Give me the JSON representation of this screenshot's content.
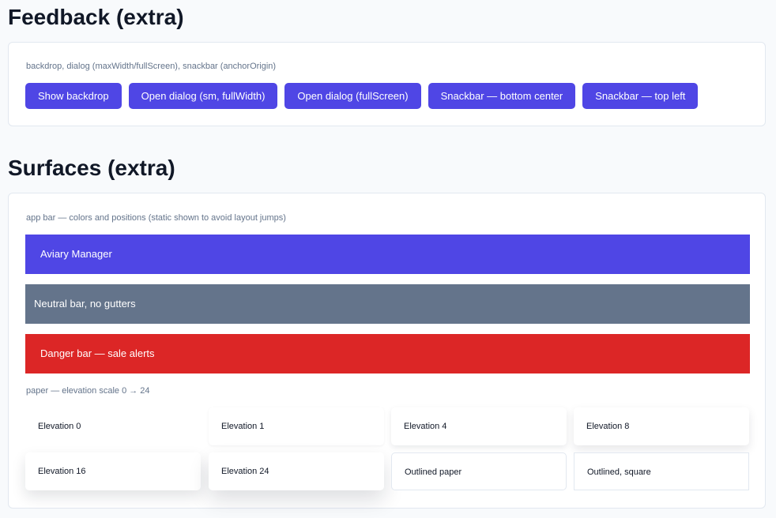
{
  "feedback": {
    "title": "Feedback (extra)",
    "caption": "backdrop, dialog (maxWidth/fullScreen), snackbar (anchorOrigin)",
    "buttons": [
      "Show backdrop",
      "Open dialog (sm, fullWidth)",
      "Open dialog (fullScreen)",
      "Snackbar — bottom center",
      "Snackbar — top left"
    ]
  },
  "surfaces": {
    "title": "Surfaces (extra)",
    "appbar_caption": "app bar — colors and positions (static shown to avoid layout jumps)",
    "appbars": [
      {
        "label": "Aviary Manager",
        "color": "#4f46e5"
      },
      {
        "label": "Neutral bar, no gutters",
        "color": "#64748b"
      },
      {
        "label": "Danger bar — sale alerts",
        "color": "#dc2626"
      }
    ],
    "paper_caption": "paper — elevation scale 0 → 24",
    "papers": [
      "Elevation 0",
      "Elevation 1",
      "Elevation 4",
      "Elevation 8",
      "Elevation 16",
      "Elevation 24",
      "Outlined paper",
      "Outlined, square"
    ]
  },
  "colors": {
    "accent": "#4f46e5",
    "neutral": "#64748b",
    "danger": "#dc2626",
    "background": "#f8fafc"
  }
}
